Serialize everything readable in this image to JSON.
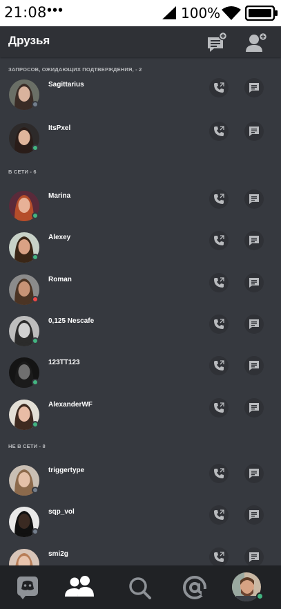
{
  "status_bar": {
    "time": "21:08",
    "dots": "•••",
    "battery_percent": "100%"
  },
  "header": {
    "title": "Друзья",
    "icons": [
      "new-message-icon",
      "add-friend-icon"
    ]
  },
  "sections": {
    "pending": "ЗАПРОСОВ, ОЖИДАЮЩИХ ПОДТВЕРЖДЕНИЯ, - 2",
    "online": "В СЕТИ - 6",
    "offline": "НЕ В СЕТИ - 8"
  },
  "friends": [
    {
      "name": "Sagittarius",
      "status": "offline"
    },
    {
      "name": "ItsPxel",
      "status": "online"
    },
    {
      "name": "Marina",
      "status": "online"
    },
    {
      "name": "Alexey",
      "status": "online"
    },
    {
      "name": "Roman",
      "status": "dnd"
    },
    {
      "name": "0,125 Nescafe",
      "status": "online"
    },
    {
      "name": "123TT123",
      "status": "online"
    },
    {
      "name": "AlexanderWF",
      "status": "online"
    },
    {
      "name": "triggertype",
      "status": "offline"
    },
    {
      "name": "sqp_vol",
      "status": "offline"
    },
    {
      "name": "smi2g",
      "status": "offline"
    }
  ],
  "row_icons": [
    "call-icon",
    "chat-icon"
  ],
  "bottom_nav": [
    "home-icon",
    "friends-icon",
    "search-icon",
    "mentions-icon",
    "profile-avatar"
  ],
  "colors": {
    "background": "#36393f",
    "header": "#2f3136",
    "nav": "#202225",
    "online": "#43b581",
    "dnd": "#f04747",
    "offline": "#747f8d"
  }
}
